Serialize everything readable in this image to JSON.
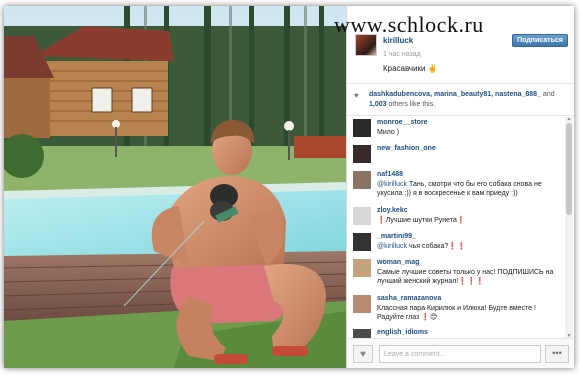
{
  "watermark": "www.schlock.ru",
  "post": {
    "username": "kirilluck",
    "time": "1 час назад",
    "caption": "Красавчики ✌️",
    "follow_label": "Подписаться"
  },
  "likes": {
    "icon": "heart-icon",
    "names": "dashkadubencova, marina_beauty81, nastena_888_",
    "suffix": " and",
    "count": "1,003",
    "rest": " others like this."
  },
  "comments": [
    {
      "user": "monroe__store",
      "text": "Мило )",
      "mention": ""
    },
    {
      "user": "new_fashion_one",
      "text": "",
      "mention": ""
    },
    {
      "user": "naf1488",
      "mention": "@kirilluck",
      "text": " Тань, смотри что бы его собака снова не укусила :)) я в воскресенье к вам приеду :))"
    },
    {
      "user": "zloy.kekc",
      "text": "❗Лучшие шутки Рунета❗",
      "mention": ""
    },
    {
      "user": "_martini99_",
      "mention": "@kirilluck",
      "text": " чья собака?❗❗"
    },
    {
      "user": "woman_mag",
      "text": "Самые лучшие советы только у нас! ПОДПИШИСЬ на лучший женский журнал!❗❗❗",
      "mention": ""
    },
    {
      "user": "sasha_ramazanova",
      "text": "Классная пара Кирилюк и Илюха! Будте вместе ! Радуйте глаз ❗😊",
      "mention": ""
    },
    {
      "user": "english_idioms",
      "text": "",
      "mention": ""
    }
  ],
  "footer": {
    "placeholder": "Leave a comment...",
    "more": "•••",
    "like_icon": "heart-icon"
  }
}
